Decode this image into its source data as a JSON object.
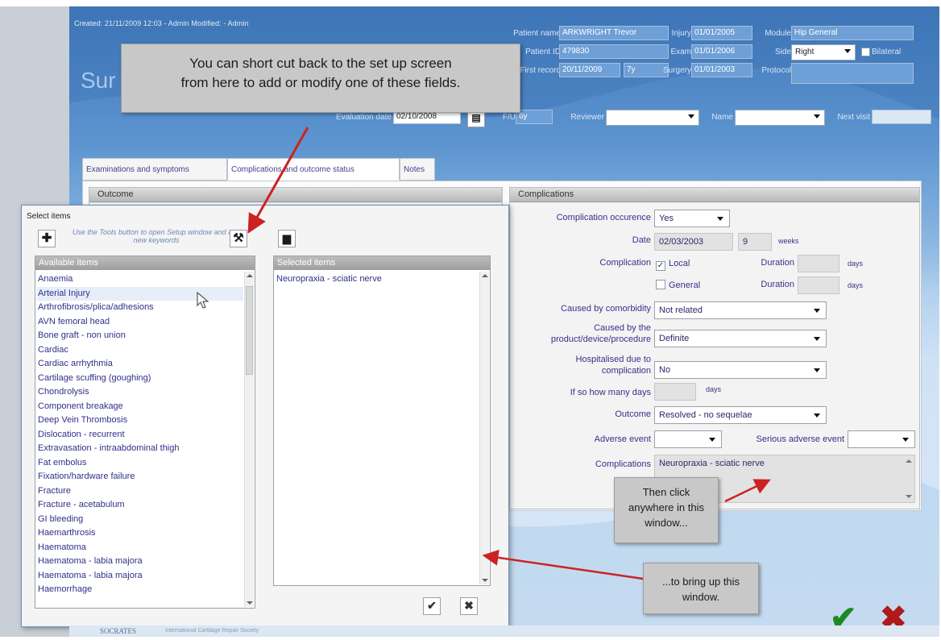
{
  "header": {
    "meta_line": "Created: 21/11/2009 12:03 - Admin   Modified:  - Admin",
    "app_title": "Sur",
    "patient_name_label": "Patient name",
    "patient_name": "ARKWRIGHT Trevor",
    "patient_id_label": "Patient ID",
    "patient_id": "479830",
    "first_record_label": "First record",
    "first_record_date": "20/11/2009",
    "first_record_span": "7y",
    "injury_label": "Injury",
    "injury_date": "01/01/2005",
    "exam_label": "Exam",
    "exam_date": "01/01/2006",
    "surgery_label": "Surgery",
    "surgery_date": "01/01/2003",
    "module_label": "Module",
    "module_value": "Hip General",
    "side_label": "Side",
    "side_value": "Right",
    "bilateral_label": "Bilateral",
    "protocol_label": "Protocol",
    "protocol_value": "",
    "evaluation_date_label": "Evaluation date",
    "evaluation_date": "02/10/2008",
    "fup_label": "F/U",
    "fup_value": "6y",
    "reviewer_label": "Reviewer",
    "reviewer_value": "",
    "name_label": "Name",
    "name_value": "",
    "next_visit_label": "Next visit",
    "next_visit_value": ""
  },
  "tabs": [
    {
      "label": "Examinations and symptoms"
    },
    {
      "label": "Complications and outcome status"
    },
    {
      "label": "Notes"
    }
  ],
  "outcome_panel": {
    "title": "Outcome"
  },
  "complications_panel": {
    "title": "Complications",
    "occurrence_label": "Complication occurence",
    "occurrence_value": "Yes",
    "date_label": "Date",
    "date_value": "02/03/2003",
    "weeks_value": "9",
    "weeks_unit": "weeks",
    "complication_label": "Complication",
    "local_label": "Local",
    "local_checked": "✓",
    "general_label": "General",
    "duration_label": "Duration",
    "duration_unit": "days",
    "comorbidity_label": "Caused by comorbidity",
    "comorbidity_value": "Not related",
    "product_label_1": "Caused by the",
    "product_label_2": "product/device/procedure",
    "product_value": "Definite",
    "hospitalised_label_1": "Hospitalised due to",
    "hospitalised_label_2": "complication",
    "hospitalised_value": "No",
    "how_many_days_label": "If so how many days",
    "how_many_days_unit": "days",
    "outcome_label": "Outcome",
    "outcome_value": "Resolved - no sequelae",
    "adverse_label": "Adverse event",
    "serious_adverse_label": "Serious adverse event",
    "complications_text_label": "Complications",
    "complications_text": "Neuropraxia - sciatic nerve"
  },
  "dialog": {
    "title": "Select items",
    "hint": "Use the Tools button to open Setup window and add new keywords",
    "available_header": "Available items",
    "selected_header": "Selected items",
    "available_items": [
      "Anaemia",
      "Arterial Injury",
      "Arthrofibrosis/plica/adhesions",
      "AVN femoral head",
      "Bone graft - non union",
      "Cardiac",
      "Cardiac arrhythmia",
      "Cartilage scuffing (goughing)",
      "Chondrolysis",
      "Component breakage",
      "Deep Vein Thrombosis",
      "Dislocation - recurrent",
      "Extravasation - intraabdominal thigh",
      "Fat embolus",
      "Fixation/hardware  failure",
      "Fracture",
      "Fracture - acetabulum",
      "GI bleeding",
      "Haemarthrosis",
      "Haematoma",
      "Haematoma - labia majora",
      "Haematoma - labia majora",
      "Haemorrhage"
    ],
    "selected_items": [
      "Neuropraxia - sciatic nerve"
    ],
    "add_icon": "plus-icon",
    "tools_icon": "tools-icon",
    "delete_icon": "trash-icon",
    "ok_icon": "check-icon",
    "cancel_icon": "close-icon"
  },
  "callouts": {
    "top_line_1": "You can short cut back to the set up screen",
    "top_line_2": "from here to add or modify one of these fields.",
    "click_line_1": "Then click",
    "click_line_2": "anywhere in this",
    "click_line_3": "window...",
    "bring_line_1": "...to bring up this",
    "bring_line_2": "window."
  },
  "footer": {
    "logo": "SOCRATES",
    "sub": "International Cartilage Repair Society"
  },
  "colors": {
    "accent_blue": "#3f78bb",
    "label_purple": "#3a2f8a",
    "ok_green": "#1d8a21",
    "cancel_red": "#b01a1a",
    "arrow_red": "#cc2222"
  }
}
